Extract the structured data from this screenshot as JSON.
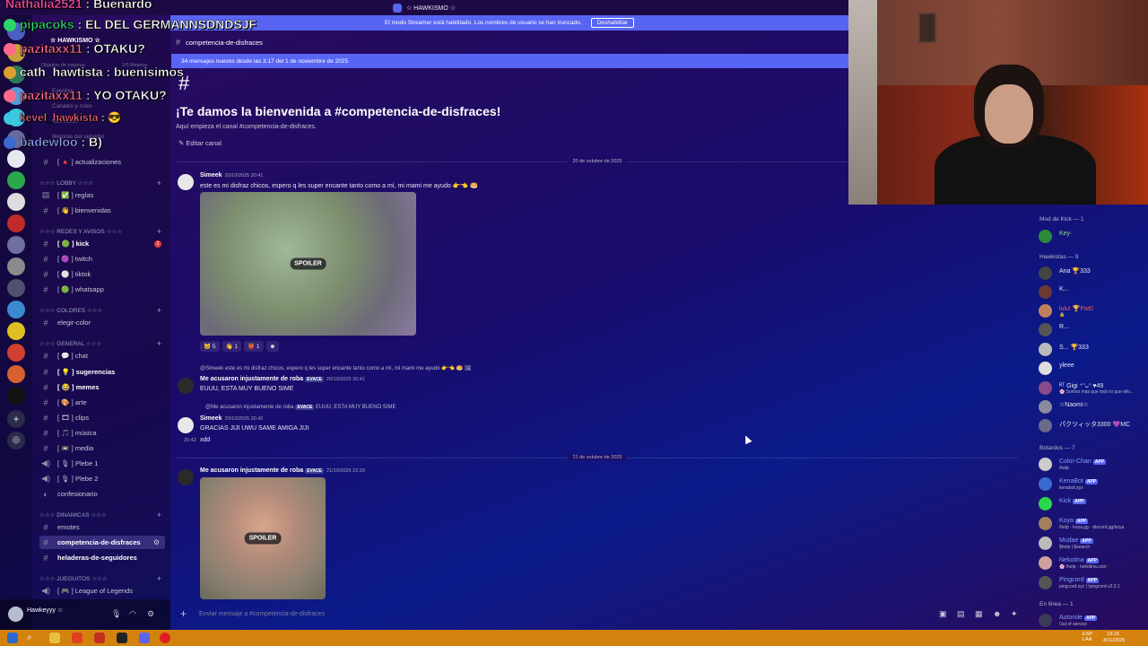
{
  "window": {
    "title": "☆ HAWKISMO ☆"
  },
  "streamer_banner": {
    "text": "El modo Streamer está habilitado. Los nombres de usuario se han truncado.",
    "button": "Deshabilitar"
  },
  "server": {
    "name": "☆ HAWKISMO ☆"
  },
  "sidebar": {
    "top_items": [
      "Objetivo de mejoras",
      "2/5 Mejoras",
      "Eventos",
      "Canales y roles",
      "Miembros",
      "Mejoras del servidor"
    ],
    "items": [
      {
        "type": "channel",
        "icon": "#",
        "label": "[ 🔺 ] actualizaciones"
      },
      {
        "type": "category",
        "label": "☆☆☆ LOBBY ☆☆☆"
      },
      {
        "type": "channel",
        "icon": "▤",
        "label": "[ ✅ ] reglas"
      },
      {
        "type": "channel",
        "icon": "#",
        "label": "[ 👋 ] bienvenidas"
      },
      {
        "type": "category",
        "label": "☆☆☆ REDES Y AVISOS ☆☆☆"
      },
      {
        "type": "channel",
        "icon": "#",
        "label": "[ 🟢 ] kick",
        "bold": true,
        "badge": "1"
      },
      {
        "type": "channel",
        "icon": "#",
        "label": "[ 🟣 ] twitch"
      },
      {
        "type": "channel",
        "icon": "#",
        "label": "[ ⚪ ] tiktok"
      },
      {
        "type": "channel",
        "icon": "#",
        "label": "[ 🟢 ] whatsapp"
      },
      {
        "type": "category",
        "label": "☆☆☆ COLORES ☆☆☆"
      },
      {
        "type": "channel",
        "icon": "#",
        "label": "elegir-color"
      },
      {
        "type": "category",
        "label": "☆☆☆ GENERAL ☆☆☆"
      },
      {
        "type": "channel",
        "icon": "#",
        "label": "[ 💬 ] chat"
      },
      {
        "type": "channel",
        "icon": "#",
        "label": "[ 💡 ] sugerencias",
        "bold": true
      },
      {
        "type": "channel",
        "icon": "#",
        "label": "[ 😂 ] memes",
        "bold": true
      },
      {
        "type": "channel",
        "icon": "#",
        "label": "[ 🎨 ] arte"
      },
      {
        "type": "channel",
        "icon": "#",
        "label": "[ 🎞 ] clips"
      },
      {
        "type": "channel",
        "icon": "#",
        "label": "[ 🎵 ] música"
      },
      {
        "type": "channel",
        "icon": "#",
        "label": "[ 📼 ] media"
      },
      {
        "type": "voice",
        "icon": "🔊",
        "label": "[ 🎙 ] Plebe 1"
      },
      {
        "type": "voice",
        "icon": "🔊",
        "label": "[ 🎙 ] Plebe 2"
      },
      {
        "type": "channel",
        "icon": "◐",
        "label": "confesionario"
      },
      {
        "type": "category",
        "label": "☆☆☆ DINÁMICAS ☆☆☆"
      },
      {
        "type": "channel",
        "icon": "#",
        "label": "emotes"
      },
      {
        "type": "channel",
        "icon": "#",
        "label": "competencia-de-disfraces",
        "bold": true,
        "active": true
      },
      {
        "type": "channel",
        "icon": "#",
        "label": "heladeras-de-seguidores",
        "bold": true
      },
      {
        "type": "category",
        "label": "☆☆☆ JUEGUITOS ☆☆☆"
      },
      {
        "type": "voice",
        "icon": "🔊",
        "label": "[ 🎮 ] League of Legends"
      }
    ]
  },
  "user_panel": {
    "name": "Hawkeyyy ☆"
  },
  "channel": {
    "name": "competencia-de-disfraces",
    "new_messages_bar": "34 mensajes nuevos desde las 3:17 del 1 de noviembre de 2025",
    "welcome_title": "¡Te damos la bienvenida a #competencia-de-disfraces!",
    "welcome_sub": "Aquí empieza el canal #competencia-de-disfraces.",
    "edit_label": "Editar canal"
  },
  "messages": {
    "date1": "20 de octubre de 2025",
    "date2": "21 de octubre de 2025",
    "m1": {
      "author": "Simeek",
      "time": "20/10/2025 20:41",
      "text": "este es mi disfraz chicos, espero q les super encante tanto como a mí, mi mami me ayudo 👉👈 🥯",
      "spoiler": "SPOILER",
      "reactions": [
        "🐱 5",
        "👋 1",
        "👹 1",
        "☻"
      ]
    },
    "m2": {
      "reply": "@Simeek este es mi disfraz chicos, espero q les super encante tanto como a mí, mi mami me ayudo 👉👈 🥯 🖼",
      "author": "Me acusaron injustamente de roba",
      "tag": "EVACE",
      "time": "20/10/2025 20:41",
      "text": "EUUU, ESTA MUY BUENO SIME"
    },
    "m3": {
      "reply": "@Me acusaron injustamente de roba",
      "reply_tag": "EVACE",
      "reply_text": "EUUU, ESTA MUY BUENO SIME",
      "author": "Simeek",
      "time": "20/10/2025 20:42",
      "text": "GRACIAS JIJI UWU SAME AMIGA JIJI",
      "time2": "20:42",
      "text2": "xdd"
    },
    "m4": {
      "author": "Me acusaron injustamente de roba",
      "tag": "EVACE",
      "time": "21/10/2025 22:29",
      "spoiler": "SPOILER"
    }
  },
  "composer": {
    "placeholder": "Enviar mensaje a #competencia-de-disfraces"
  },
  "members": {
    "groups": [
      {
        "header": "Mod de Kick — 1",
        "members": [
          {
            "name": "Key·",
            "color": "#7ee07a"
          }
        ]
      },
      {
        "header": "Hawkistas — 9",
        "members": [
          {
            "name": "Ana 🏆333",
            "color": "#e6e7ee"
          },
          {
            "name": "K...",
            "color": "#e6e7ee"
          },
          {
            "name": "lulu! 🏆Pat0",
            "color": "#ff5a5a",
            "sub": "🔒"
          },
          {
            "name": "R...",
            "color": "#e6e7ee"
          },
          {
            "name": "S... 🏆333",
            "color": "#e6e7ee"
          },
          {
            "name": "yleee",
            "color": "#e6e7ee"
          },
          {
            "name": "ᴿᵀ Gigi ⁺ᵔᴗᵔ ♥49",
            "color": "#e6e7ee",
            "sub": "🌸 Somos más que todo lo que ello..."
          },
          {
            "name": "☆Naomi☆",
            "color": "#e6e7ee"
          },
          {
            "name": "パクツィッタ3300 💜MC",
            "color": "#e6e7ee"
          }
        ]
      },
      {
        "header": "Botardos — 7",
        "members": [
          {
            "name": "Color-Chan",
            "app": "APP",
            "color": "#7fa0ff",
            "sub": "/help"
          },
          {
            "name": "KenaBot",
            "app": "APP",
            "color": "#7fa0ff",
            "sub": "kenabot.xyz"
          },
          {
            "name": "Kick",
            "app": "APP",
            "color": "#7fa0ff"
          },
          {
            "name": "Koya",
            "app": "APP",
            "color": "#7fa0ff",
            "sub": "/help · koya.gg · discord.gg/koya"
          },
          {
            "name": "Mudae",
            "app": "APP",
            "color": "#7fa0ff",
            "sub": "$help | $search"
          },
          {
            "name": "Nekotina",
            "app": "APP",
            "color": "#7fa0ff",
            "sub": "🌸 /help - nekotina.com"
          },
          {
            "name": "Pingcord",
            "app": "APP",
            "color": "#7fa0ff",
            "sub": "pingcord.xyz | !pingcord v2.2.1"
          }
        ]
      },
      {
        "header": "En línea — 1",
        "members": [
          {
            "name": "Autorole",
            "app": "APP",
            "color": "#7fa0ff",
            "sub": "Out of service"
          }
        ]
      }
    ]
  },
  "chat_overlay": [
    {
      "name": "Nathalia2521",
      "sep": ":",
      "text": "Buenardo",
      "color": "#ff4fa0"
    },
    {
      "name": "pipacoks",
      "sep": ":",
      "text": "EL DEL GERMANNSDNDSJF",
      "color": "#2ad66a"
    },
    {
      "name": "pazitaxx11",
      "sep": ":",
      "text": "OTAKU?",
      "color": "#ff6a8a"
    },
    {
      "name": "cath_hawtista",
      "sep": ":",
      "text": "buenisimos",
      "color": "#ffffff"
    },
    {
      "name": "pazitaxx11",
      "sep": ":",
      "text": "YO OTAKU?",
      "color": "#ff6a8a"
    },
    {
      "name": "kevel_hawkista",
      "sep": ":",
      "text": "😎",
      "color": "#ff6a8a"
    },
    {
      "name": "badewloo",
      "sep": ":",
      "text": "B)",
      "color": "#9aa6ff"
    }
  ],
  "taskbar": {
    "locale": "ESP\nLAA",
    "time": "19:16",
    "date": "4/11/2025"
  },
  "colors": {
    "accent": "#5865f2",
    "badge": "#e03d40",
    "taskbar": "#d4820e"
  }
}
